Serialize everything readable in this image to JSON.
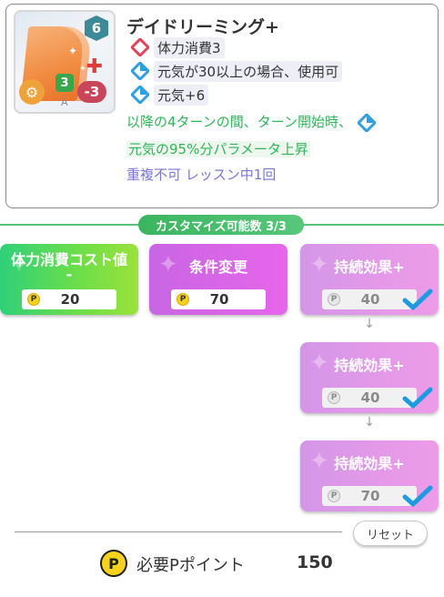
{
  "card": {
    "title": "デイドリーミング+",
    "cost_badge": "6",
    "green_badge": "3",
    "grade": "A",
    "red_badge": "-3",
    "effects": [
      {
        "icon": "red-diamond",
        "text": "体力消費3"
      },
      {
        "icon": "blue-diamond",
        "text": "元気が30以上の場合、使用可"
      },
      {
        "icon": "blue-diamond",
        "text": "元気+6"
      }
    ],
    "green_line1": "以降の4ターンの間、ターン開始時、",
    "green_line2": "元気の95%分パラメータ上昇",
    "purple_line": "重複不可 レッスン中1回"
  },
  "customize": {
    "header": "カスタマイズ可能数 3/3",
    "coin_letter": "P",
    "tiles": [
      {
        "title_line1": "体力消費コスト値",
        "title_line2": "-",
        "cost": "20",
        "done": false
      },
      {
        "title": "条件変更",
        "cost": "70",
        "done": false
      },
      {
        "title": "持続効果+",
        "cost": "40",
        "done": true
      },
      {
        "title": "持続効果+",
        "cost": "40",
        "done": true
      },
      {
        "title": "持続効果+",
        "cost": "70",
        "done": true
      }
    ],
    "arrow": "↓"
  },
  "footer": {
    "reset_label": "リセット",
    "coin_letter": "P",
    "required_label": "必要Pポイント",
    "required_value": "150"
  },
  "colors": {
    "green_text": "#2fb65a",
    "purple_text": "#7a77d8",
    "check_blue": "#1e9be0",
    "header_green": "#3ab55f"
  }
}
